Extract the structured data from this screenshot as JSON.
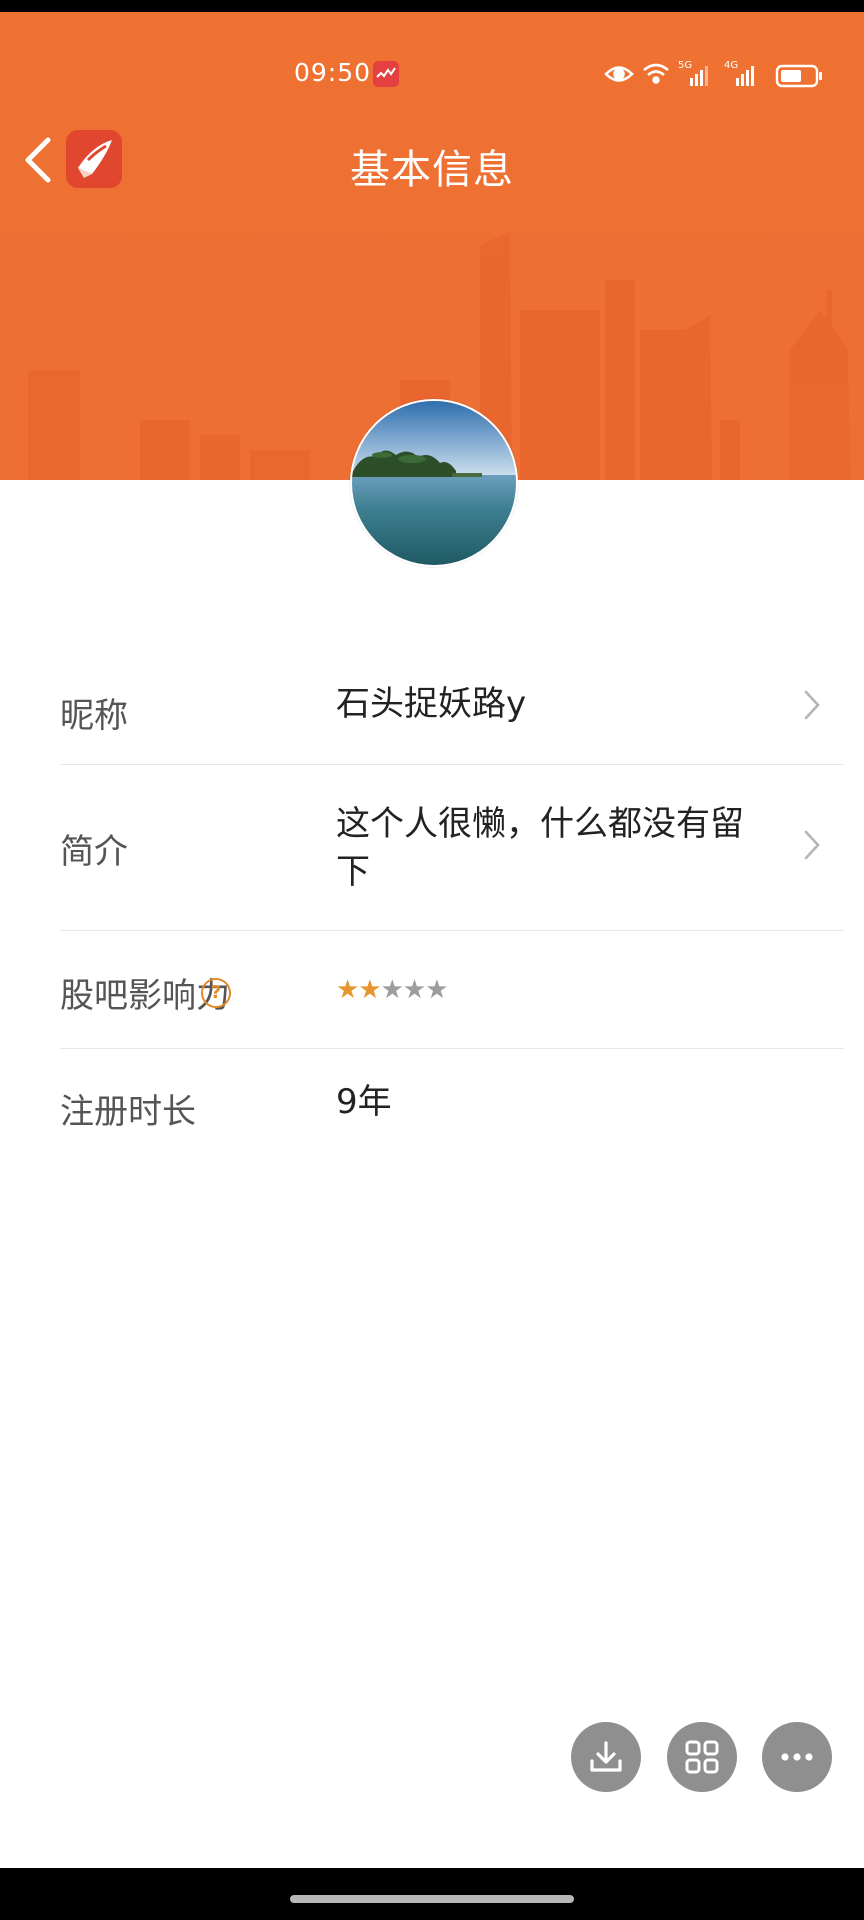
{
  "status_bar": {
    "time": "09:50",
    "signal_1_label": "5G",
    "signal_2_label": "4G"
  },
  "header": {
    "title": "基本信息",
    "back_icon": "chevron-left-icon",
    "logo_icon": "app-logo-icon"
  },
  "profile": {
    "rows": [
      {
        "label": "昵称",
        "value": "石头捉妖路y"
      },
      {
        "label": "简介",
        "value_line1": "这个人很懒，什么都没有留",
        "value_line2": "下"
      },
      {
        "label": "股吧影响力",
        "help": "?",
        "rating": 2,
        "rating_max": 5
      },
      {
        "label": "注册时长",
        "value": "9年"
      }
    ]
  },
  "stars": {
    "on": "★★",
    "off": "★★★"
  },
  "colors": {
    "header": "#ef7033",
    "accent": "#e28a2b",
    "fab": "#8f8f8f"
  },
  "fab_icons": [
    "download-icon",
    "grid-icon",
    "more-icon"
  ]
}
